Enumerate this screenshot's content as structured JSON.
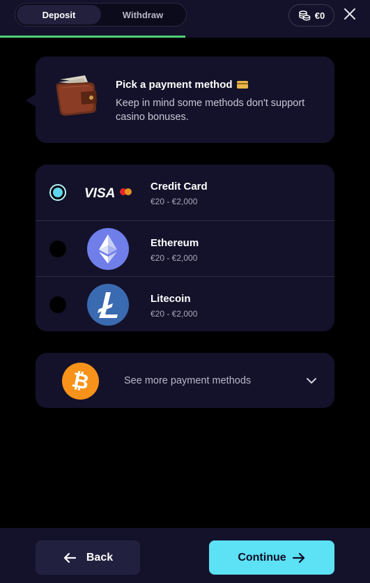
{
  "header": {
    "tabs": [
      {
        "label": "Deposit",
        "active": true
      },
      {
        "label": "Withdraw",
        "active": false
      }
    ],
    "balance": "€0",
    "balance_icon": "coins-icon",
    "close_icon": "close-icon",
    "progress": 0.5
  },
  "info": {
    "title": "Pick a payment method",
    "text": "Keep in mind some methods don't support casino bonuses."
  },
  "methods": [
    {
      "name": "Credit Card",
      "range": "€20 - €2,000",
      "logo_text": "VISA",
      "logo_icon": "visa-mastercard-icon",
      "selected": true
    },
    {
      "name": "Ethereum",
      "range": "€20 - €2,000",
      "logo_icon": "ethereum-icon",
      "selected": false
    },
    {
      "name": "Litecoin",
      "range": "€20 - €2,000",
      "logo_icon": "litecoin-icon",
      "selected": false
    }
  ],
  "more": {
    "label": "See more payment methods",
    "icon": "bitcoin-icon"
  },
  "footer": {
    "back_label": "Back",
    "continue_label": "Continue"
  },
  "colors": {
    "accent": "#5ce1f5",
    "panel": "#14122a",
    "progress": "#4fd27a"
  }
}
